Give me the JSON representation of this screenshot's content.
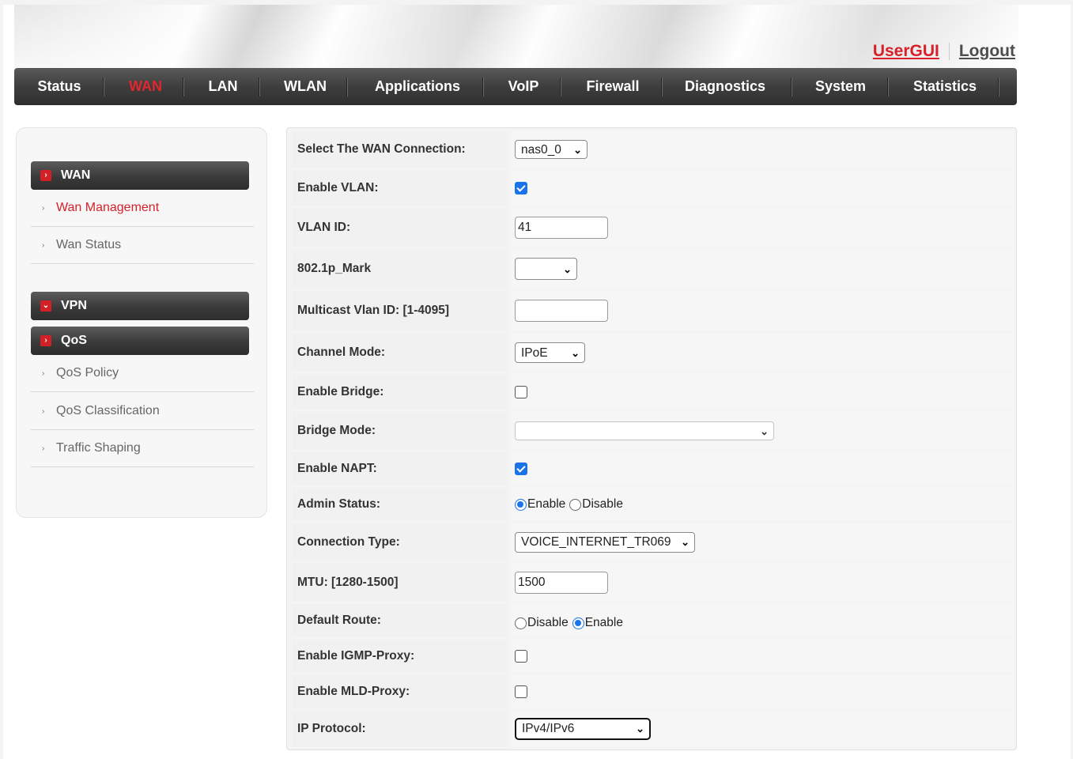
{
  "header": {
    "usergui_link": "UserGUI",
    "logout_link": "Logout"
  },
  "nav": {
    "items": [
      "Status",
      "WAN",
      "LAN",
      "WLAN",
      "Applications",
      "VoIP",
      "Firewall",
      "Diagnostics",
      "System",
      "Statistics"
    ],
    "active": "WAN"
  },
  "sidebar": {
    "sections": [
      {
        "label": "WAN",
        "icon": "chevron-right-icon"
      },
      {
        "label": "VPN",
        "icon": "chevron-down-icon"
      },
      {
        "label": "QoS",
        "icon": "chevron-right-icon"
      }
    ],
    "wan_items": [
      "Wan Management",
      "Wan Status"
    ],
    "qos_items": [
      "QoS Policy",
      "QoS Classification",
      "Traffic Shaping"
    ],
    "active_item": "Wan Management"
  },
  "form": {
    "wan_connection": {
      "label": "Select The WAN Connection:",
      "value": "nas0_0"
    },
    "enable_vlan": {
      "label": "Enable VLAN:",
      "checked": true
    },
    "vlan_id": {
      "label": "VLAN ID:",
      "value": "41"
    },
    "mark_8021p": {
      "label": "802.1p_Mark",
      "value": ""
    },
    "multicast_vlan": {
      "label": "Multicast Vlan ID: [1-4095]",
      "value": ""
    },
    "channel_mode": {
      "label": "Channel Mode:",
      "value": "IPoE"
    },
    "enable_bridge": {
      "label": "Enable Bridge:",
      "checked": false
    },
    "bridge_mode": {
      "label": "Bridge Mode:",
      "value": ""
    },
    "enable_napt": {
      "label": "Enable NAPT:",
      "checked": true
    },
    "admin_status": {
      "label": "Admin Status:",
      "options": [
        "Enable",
        "Disable"
      ],
      "selected": "Enable"
    },
    "connection_type": {
      "label": "Connection Type:",
      "value": "VOICE_INTERNET_TR069"
    },
    "mtu": {
      "label": "MTU: [1280-1500]",
      "value": "1500"
    },
    "default_route": {
      "label": "Default Route:",
      "options": [
        "Disable",
        "Enable"
      ],
      "selected": "Enable"
    },
    "igmp_proxy": {
      "label": "Enable IGMP-Proxy:",
      "checked": false
    },
    "mld_proxy": {
      "label": "Enable MLD-Proxy:",
      "checked": false
    },
    "ip_protocol": {
      "label": "IP Protocol:",
      "value": "IPv4/IPv6"
    }
  },
  "colors": {
    "accent_red": "#d6202a",
    "checkbox_blue": "#1a73e8",
    "nav_dark": "#3e3e3e"
  }
}
